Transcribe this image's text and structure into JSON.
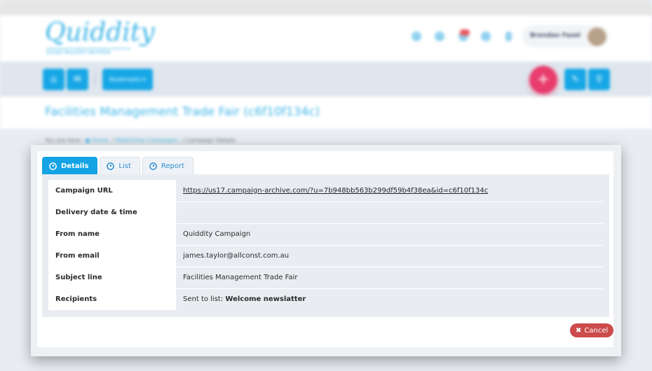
{
  "app": {
    "logo": "Quiddity",
    "tagline": "Simple Beautiful Workflow",
    "user_name": "Brendan Fazel",
    "bookmarks_label": "Bookmarks ▾",
    "page_title": "Facilities Management Trade Fair (c6f10f134c)",
    "breadcrumb": {
      "prefix": "You are here:",
      "items": [
        "Home",
        "MailChimp Campaigns",
        "Campaign Details"
      ]
    }
  },
  "modal": {
    "tabs": [
      {
        "label": "Details",
        "active": true,
        "icon": "mailchimp-icon"
      },
      {
        "label": "List",
        "active": false,
        "icon": "mailchimp-icon"
      },
      {
        "label": "Report",
        "active": false,
        "icon": "mailchimp-icon"
      }
    ],
    "rows": [
      {
        "label": "Campaign URL",
        "value": "https://us17.campaign-archive.com/?u=7b948bb563b299df59b4f38ea&id=c6f10f134c"
      },
      {
        "label": "Delivery date & time",
        "value": ""
      },
      {
        "label": "From name",
        "value": "Quiddity Campaign"
      },
      {
        "label": "From email",
        "value": "james.taylor@allconst.com.au"
      },
      {
        "label": "Subject line",
        "value": "Facilities Management Trade Fair"
      },
      {
        "label": "Recipients",
        "value_prefix": "Sent to list: ",
        "value_bold": "Welcome newslatter"
      }
    ],
    "cancel_label": "Cancel"
  },
  "colors": {
    "accent": "#14a3e5",
    "cancel": "#cc4b4b",
    "fab": "#e83c6c"
  }
}
